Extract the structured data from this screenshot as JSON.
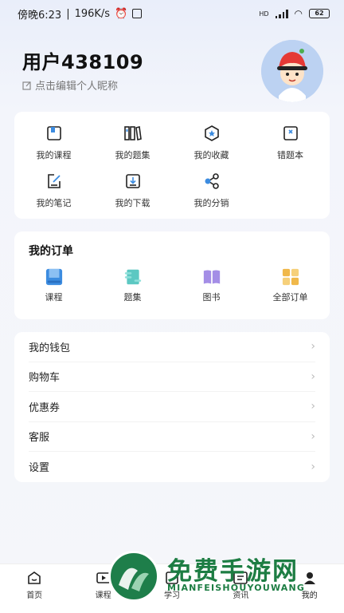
{
  "status": {
    "time": "傍晚6:23",
    "speed": "196K/s",
    "battery": "62",
    "network": "HD"
  },
  "profile": {
    "username": "用户438109",
    "edit_hint": "点击编辑个人昵称"
  },
  "grid": {
    "items": [
      {
        "label": "我的课程",
        "icon": "course-book-icon"
      },
      {
        "label": "我的题集",
        "icon": "question-set-icon"
      },
      {
        "label": "我的收藏",
        "icon": "favorite-icon"
      },
      {
        "label": "错题本",
        "icon": "wrong-notebook-icon"
      },
      {
        "label": "我的笔记",
        "icon": "notes-icon"
      },
      {
        "label": "我的下载",
        "icon": "download-icon"
      },
      {
        "label": "我的分销",
        "icon": "share-icon"
      }
    ]
  },
  "orders": {
    "title": "我的订单",
    "items": [
      {
        "label": "课程",
        "icon": "course-icon",
        "color": "#3c8ce0"
      },
      {
        "label": "题集",
        "icon": "question-set-icon",
        "color": "#5cc8c2"
      },
      {
        "label": "图书",
        "icon": "book-icon",
        "color": "#a48ee6"
      },
      {
        "label": "全部订单",
        "icon": "all-orders-icon",
        "color": "#f0b84a"
      }
    ]
  },
  "list": {
    "items": [
      {
        "label": "我的钱包"
      },
      {
        "label": "购物车"
      },
      {
        "label": "优惠券"
      },
      {
        "label": "客服"
      },
      {
        "label": "设置"
      }
    ]
  },
  "tabs": {
    "items": [
      {
        "label": "首页"
      },
      {
        "label": "课程"
      },
      {
        "label": "学习"
      },
      {
        "label": "资讯"
      },
      {
        "label": "我的"
      }
    ]
  },
  "watermark": {
    "title": "免费手游网",
    "subtitle": "MIANFEISHOUYOUWANG"
  }
}
